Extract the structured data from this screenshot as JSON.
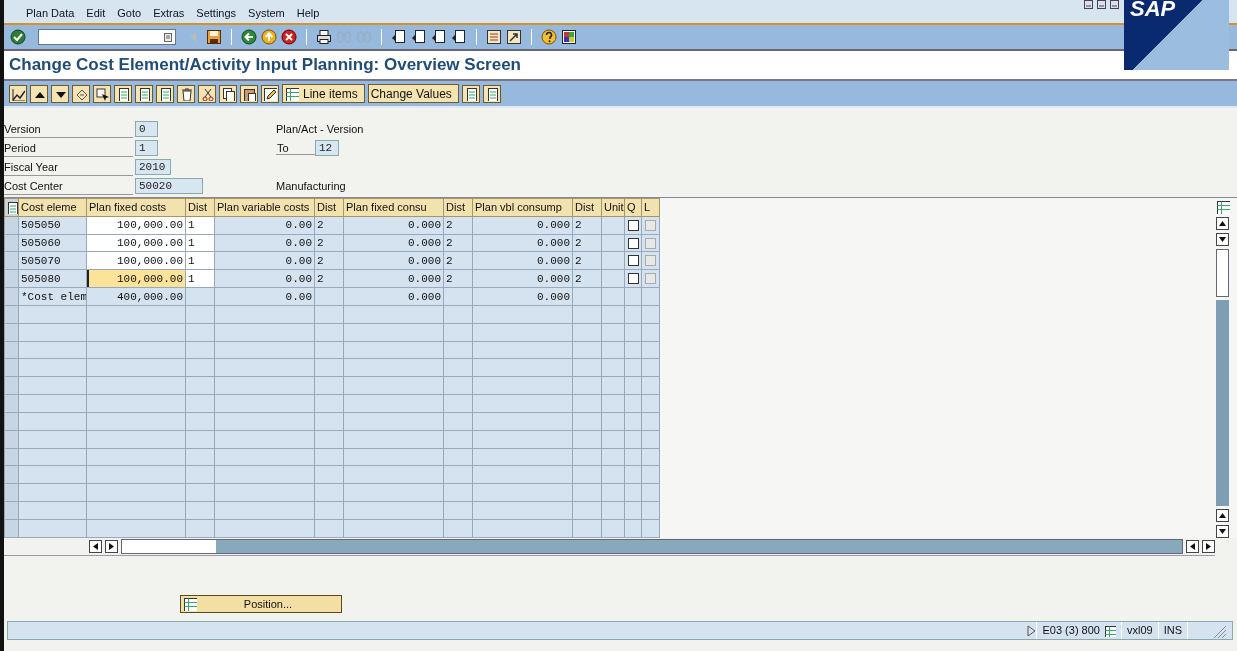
{
  "menu": [
    "Plan Data",
    "Edit",
    "Goto",
    "Extras",
    "Settings",
    "System",
    "Help"
  ],
  "logo": "SAP",
  "title": "Change Cost Element/Activity Input Planning: Overview Screen",
  "app_toolbar": {
    "buttons": [
      "Line items",
      "Change Values"
    ]
  },
  "header_fields": [
    {
      "label": "Version",
      "value": "0",
      "description": "Plan/Act - Version"
    },
    {
      "label": "Period",
      "value": "1",
      "to_label": "To",
      "to_value": "12"
    },
    {
      "label": "Fiscal Year",
      "value": "2010"
    },
    {
      "label": "Cost Center",
      "value": "50020",
      "description": "Manufacturing"
    }
  ],
  "table": {
    "columns": [
      {
        "label": "Cost eleme",
        "editable": false
      },
      {
        "label": "Plan fixed costs",
        "editable": true
      },
      {
        "label": "Dist",
        "editable": true
      },
      {
        "label": "Plan variable costs",
        "editable": false
      },
      {
        "label": "Dist",
        "editable": false
      },
      {
        "label": "Plan fixed consu",
        "editable": false
      },
      {
        "label": "Dist",
        "editable": false
      },
      {
        "label": "Plan vbl consump",
        "editable": false
      },
      {
        "label": "Dist",
        "editable": false
      },
      {
        "label": "Unit"
      },
      {
        "label": "Q"
      },
      {
        "label": "L"
      }
    ],
    "rows": [
      {
        "kind": "data",
        "focused": false,
        "cells": [
          "505050",
          "100,000.00",
          "1",
          "0.00",
          "2",
          "0.000",
          "2",
          "0.000",
          "2",
          ""
        ],
        "q": {
          "checked": false,
          "disabled": false
        },
        "l": {
          "checked": false,
          "disabled": true
        }
      },
      {
        "kind": "data",
        "focused": false,
        "cells": [
          "505060",
          "100,000.00",
          "1",
          "0.00",
          "2",
          "0.000",
          "2",
          "0.000",
          "2",
          ""
        ],
        "q": {
          "checked": false,
          "disabled": false
        },
        "l": {
          "checked": false,
          "disabled": true
        }
      },
      {
        "kind": "data",
        "focused": false,
        "cells": [
          "505070",
          "100,000.00",
          "1",
          "0.00",
          "2",
          "0.000",
          "2",
          "0.000",
          "2",
          ""
        ],
        "q": {
          "checked": false,
          "disabled": false
        },
        "l": {
          "checked": false,
          "disabled": true
        }
      },
      {
        "kind": "data",
        "focused": true,
        "cells": [
          "505080",
          "100,000.00",
          "1",
          "0.00",
          "2",
          "0.000",
          "2",
          "0.000",
          "2",
          ""
        ],
        "q": {
          "checked": false,
          "disabled": false
        },
        "l": {
          "checked": false,
          "disabled": true
        }
      },
      {
        "kind": "total",
        "cells": [
          "*Cost elem",
          "400,000.00",
          "",
          "0.00",
          "",
          "0.000",
          "",
          "0.000",
          "",
          ""
        ]
      }
    ]
  },
  "position_button": "Position...",
  "status_bar": {
    "system": "E03 (3) 800",
    "server": "vxl09",
    "mode": "INS"
  }
}
